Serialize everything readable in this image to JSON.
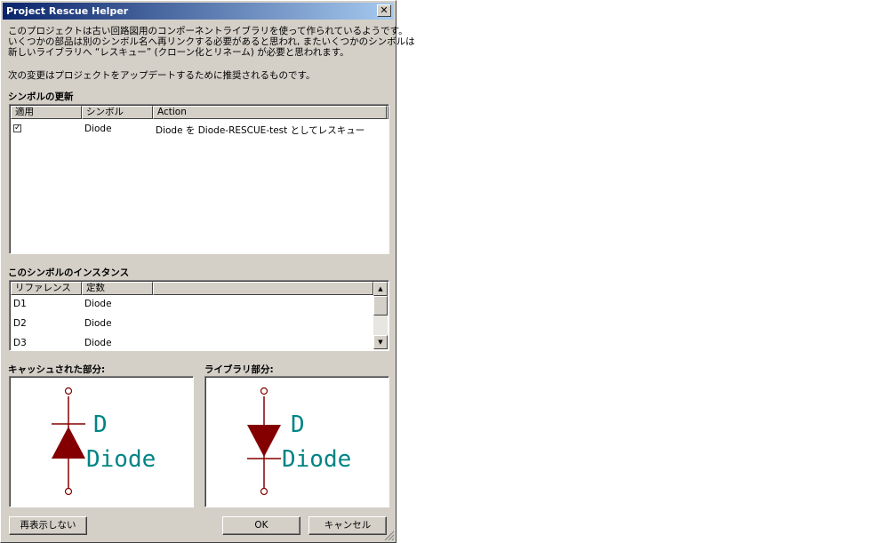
{
  "window": {
    "title": "Project Rescue Helper"
  },
  "intro": {
    "line1": "このプロジェクトは古い回路図用のコンポーネントライブラリを使って作られているようです。",
    "line2": "いくつかの部品は別のシンボル名へ再リンクする必要があると思われ, またいくつかのシンボルは",
    "line3": "新しいライブラリへ “レスキュー” (クローン化とリネーム) が必要と思われます。",
    "recommend": "次の変更はプロジェクトをアップデートするために推奨されるものです。"
  },
  "symbols": {
    "heading": "シンボルの更新",
    "columns": [
      "適用",
      "シンボル",
      "Action"
    ],
    "rows": [
      {
        "checked": "✓",
        "symbol": "Diode",
        "action": "Diode を Diode-RESCUE-test としてレスキュー"
      }
    ]
  },
  "instances": {
    "heading": "このシンボルのインスタンス",
    "columns": [
      "リファレンス",
      "定数"
    ],
    "rows": [
      {
        "ref": "D1",
        "value": "Diode"
      },
      {
        "ref": "D2",
        "value": "Diode"
      },
      {
        "ref": "D3",
        "value": "Diode"
      }
    ]
  },
  "preview": {
    "cached_label": "キャッシュされた部分:",
    "library_label": "ライブラリ部分:",
    "cached": {
      "ref": "D",
      "value": "Diode"
    },
    "library": {
      "ref": "D",
      "value": "Diode"
    }
  },
  "buttons": {
    "dont_show": "再表示しない",
    "ok": "OK",
    "cancel": "キャンセル"
  },
  "colors": {
    "symbol_body": "#840000",
    "symbol_text": "#008484",
    "title_bar": "#0a246a"
  }
}
